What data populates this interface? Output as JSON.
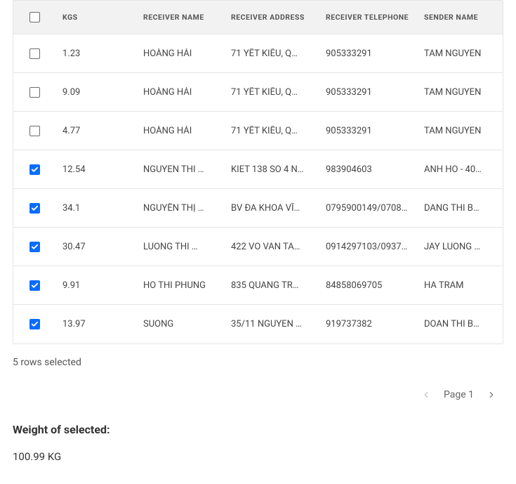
{
  "headers": {
    "kgs": "KGS",
    "receiver_name": "RECEIVER NAME",
    "receiver_address": "RECEIVER ADDRESS",
    "receiver_telephone": "RECEIVER TELEPHONE",
    "sender_name": "SENDER NAME"
  },
  "rows": [
    {
      "checked": false,
      "kgs": "1.23",
      "rname": "HOÀNG HẢI",
      "raddr": "71 YẾT KIÊU, Q…",
      "rtel": "905333291",
      "sname": "TAM NGUYEN"
    },
    {
      "checked": false,
      "kgs": "9.09",
      "rname": "HOÀNG HẢI",
      "raddr": "71 YẾT KIÊU, Q…",
      "rtel": "905333291",
      "sname": "TAM NGUYEN"
    },
    {
      "checked": false,
      "kgs": "4.77",
      "rname": "HOÀNG HẢI",
      "raddr": "71 YẾT KIÊU, Q…",
      "rtel": "905333291",
      "sname": "TAM NGUYEN"
    },
    {
      "checked": true,
      "kgs": "12.54",
      "rname": "NGUYEN THI …",
      "raddr": "KIET 138 SO 4 N…",
      "rtel": "983904603",
      "sname": "ANH HO - 40…"
    },
    {
      "checked": true,
      "kgs": "34.1",
      "rname": "NGUYỄN THỊ …",
      "raddr": "BV ĐA KHOA VĨ…",
      "rtel": "0795900149/0708…",
      "sname": "DANG THI B…"
    },
    {
      "checked": true,
      "kgs": "30.47",
      "rname": "LUONG THI …",
      "raddr": "422 VO VAN TA…",
      "rtel": "0914297103/0937…",
      "sname": "JAY LUONG …"
    },
    {
      "checked": true,
      "kgs": "9.91",
      "rname": "HO THI PHUNG",
      "raddr": "835 QUANG TR…",
      "rtel": "84858069705",
      "sname": "HA TRAM"
    },
    {
      "checked": true,
      "kgs": "13.97",
      "rname": "SUONG",
      "raddr": "35/11 NGUYEN …",
      "rtel": "919737382",
      "sname": "DOAN THI B…"
    }
  ],
  "selection_text": "5 rows selected",
  "pager": {
    "label": "Page 1"
  },
  "weight": {
    "label": "Weight of selected:",
    "value": "100.99 KG"
  }
}
